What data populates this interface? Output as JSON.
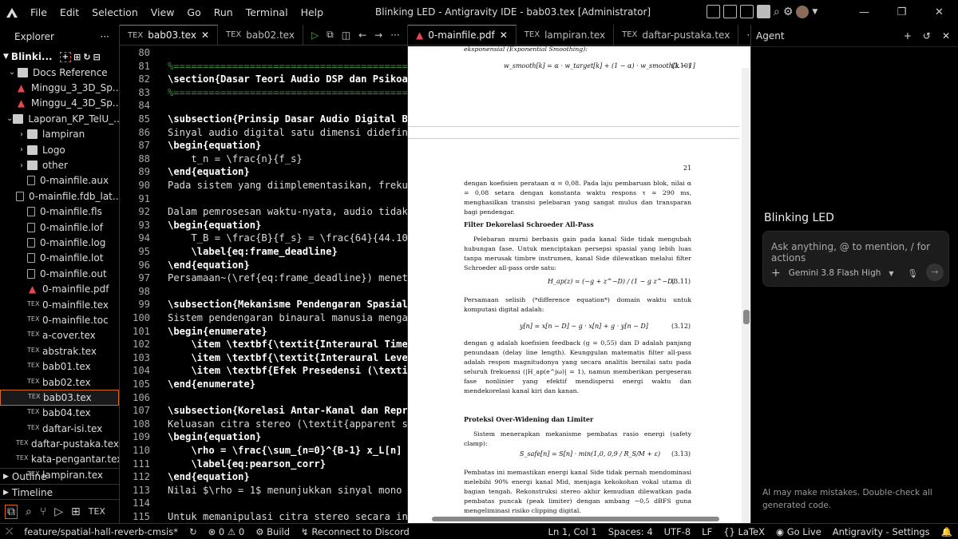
{
  "title": {
    "menu": [
      "File",
      "Edit",
      "Selection",
      "View",
      "Go",
      "Run",
      "Terminal",
      "Help"
    ],
    "window_title": "Blinking LED - Antigravity IDE - bab03.tex [Administrator]"
  },
  "sidebar": {
    "header": "Explorer",
    "root": "Blinki...",
    "items": [
      {
        "label": "Docs Reference",
        "type": "folder-open",
        "indent": 1
      },
      {
        "label": "Minggu_3_3D_Sp...",
        "type": "pdf",
        "indent": 2
      },
      {
        "label": "Minggu_4_3D_Sp...",
        "type": "pdf",
        "indent": 2
      },
      {
        "label": "Laporan_KP_TelU_...",
        "type": "folder-open",
        "indent": 1
      },
      {
        "label": "lampiran",
        "type": "folder",
        "indent": 2
      },
      {
        "label": "Logo",
        "type": "folder",
        "indent": 2
      },
      {
        "label": "other",
        "type": "folder",
        "indent": 2
      },
      {
        "label": "0-mainfile.aux",
        "type": "file",
        "indent": 2
      },
      {
        "label": "0-mainfile.fdb_lat...",
        "type": "file",
        "indent": 2
      },
      {
        "label": "0-mainfile.fls",
        "type": "file",
        "indent": 2
      },
      {
        "label": "0-mainfile.lof",
        "type": "file",
        "indent": 2
      },
      {
        "label": "0-mainfile.log",
        "type": "file",
        "indent": 2
      },
      {
        "label": "0-mainfile.lot",
        "type": "file",
        "indent": 2
      },
      {
        "label": "0-mainfile.out",
        "type": "file",
        "indent": 2
      },
      {
        "label": "0-mainfile.pdf",
        "type": "pdf",
        "indent": 2
      },
      {
        "label": "0-mainfile.tex",
        "type": "tex",
        "indent": 2
      },
      {
        "label": "0-mainfile.toc",
        "type": "tex",
        "indent": 2
      },
      {
        "label": "a-cover.tex",
        "type": "tex",
        "indent": 2
      },
      {
        "label": "abstrak.tex",
        "type": "tex",
        "indent": 2
      },
      {
        "label": "bab01.tex",
        "type": "tex",
        "indent": 2
      },
      {
        "label": "bab02.tex",
        "type": "tex",
        "indent": 2
      },
      {
        "label": "bab03.tex",
        "type": "tex",
        "indent": 2,
        "selected": true
      },
      {
        "label": "bab04.tex",
        "type": "tex",
        "indent": 2
      },
      {
        "label": "daftar-isi.tex",
        "type": "tex",
        "indent": 2
      },
      {
        "label": "daftar-pustaka.tex",
        "type": "tex",
        "indent": 2
      },
      {
        "label": "kata-pengantar.tex",
        "type": "tex",
        "indent": 2
      },
      {
        "label": "lampiran.tex",
        "type": "tex",
        "indent": 2
      }
    ],
    "outline": "Outline",
    "timeline": "Timeline"
  },
  "editor": {
    "tabs": [
      {
        "label": "bab03.tex",
        "active": true
      },
      {
        "label": "bab02.tex",
        "active": false
      }
    ],
    "lines": [
      {
        "n": "80",
        "t": ""
      },
      {
        "n": "81",
        "t": "%==========================================="
      },
      {
        "n": "82",
        "t": "\\section{Dasar Teori Audio DSP dan Psikoak"
      },
      {
        "n": "83",
        "t": "%==========================================="
      },
      {
        "n": "84",
        "t": ""
      },
      {
        "n": "85",
        "t": "\\subsection{Prinsip Dasar Audio Digital Be"
      },
      {
        "n": "86",
        "t": "Sinyal audio digital satu dimensi didefini"
      },
      {
        "n": "87",
        "t": "\\begin{equation}"
      },
      {
        "n": "88",
        "t": "    t_n = \\frac{n}{f_s}"
      },
      {
        "n": "89",
        "t": "\\end{equation}"
      },
      {
        "n": "90",
        "t": "Pada sistem yang diimplementasikan, frekue"
      },
      {
        "n": "91",
        "t": ""
      },
      {
        "n": "92",
        "t": "Dalam pemrosesan waktu-nyata, audio tidak"
      },
      {
        "n": "93",
        "t": "\\begin{equation}"
      },
      {
        "n": "94",
        "t": "    T_B = \\frac{B}{f_s} = \\frac{64}{44.100"
      },
      {
        "n": "95",
        "t": "    \\label{eq:frame_deadline}"
      },
      {
        "n": "96",
        "t": "\\end{equation}"
      },
      {
        "n": "97",
        "t": "Persamaan~(\\ref{eq:frame_deadline}) meneta"
      },
      {
        "n": "98",
        "t": ""
      },
      {
        "n": "99",
        "t": "\\subsection{Mekanisme Pendengaran Spasial"
      },
      {
        "n": "100",
        "t": "Sistem pendengaran binaural manusia mengan"
      },
      {
        "n": "101",
        "t": "\\begin{enumerate}"
      },
      {
        "n": "102",
        "t": "    \\item \\textbf{\\textit{Interaural Time"
      },
      {
        "n": "103",
        "t": "    \\item \\textbf{\\textit{Interaural Level"
      },
      {
        "n": "104",
        "t": "    \\item \\textbf{Efek Presedensi (\\textit"
      },
      {
        "n": "105",
        "t": "\\end{enumerate}"
      },
      {
        "n": "106",
        "t": ""
      },
      {
        "n": "107",
        "t": "\\subsection{Korelasi Antar-Kanal dan Repre"
      },
      {
        "n": "108",
        "t": "Keluasan citra stereo (\\textit{apparent so"
      },
      {
        "n": "109",
        "t": "\\begin{equation}"
      },
      {
        "n": "110",
        "t": "    \\rho = \\frac{\\sum_{n=0}^{B-1} x_L[n] x"
      },
      {
        "n": "111",
        "t": "    \\label{eq:pearson_corr}"
      },
      {
        "n": "112",
        "t": "\\end{equation}"
      },
      {
        "n": "113",
        "t": "Nilai $\\rho = 1$ menunjukkan sinyal mono m"
      },
      {
        "n": "114",
        "t": ""
      },
      {
        "n": "115",
        "t": "Untuk memanipulasi citra stereo secara ind"
      }
    ]
  },
  "pdf": {
    "tabs": [
      {
        "label": "0-mainfile.pdf",
        "active": true
      },
      {
        "label": "lampiran.tex",
        "active": false
      },
      {
        "label": "daftar-pustaka.tex",
        "active": false
      }
    ],
    "top_caption": "eksponensial (Exponential Smoothing):",
    "eq310": "w_smooth[k] = α · w_target[k] + (1 − α) · w_smooth[k − 1]",
    "eq310n": "(3.10)",
    "page": "21",
    "p1": "dengan koefisien perataan α = 0,08. Pada laju pembaruan blok, nilai α = 0,08 setara dengan konstanta waktu respons τ ≈ 290 ms, menghasilkan transisi pelebaran yang sangat mulus dan transparan bagi pendengar.",
    "h1": "Filter Dekorelasi Schroeder All-Pass",
    "p2": "Pelebaran murni berbasis gain pada kanal Side tidak mengubah hubungan fase. Untuk menciptakan persepsi spasial yang lebih luas tanpa merusak timbre instrumen, kanal Side dilewatkan melalui filter Schroeder all-pass orde satu:",
    "eq311": "H_ap(z) = (−g + z^−D) / (1 − g z^−D)",
    "eq311n": "(3.11)",
    "p3": "Persamaan selisih (*difference equation*) domain waktu untuk komputasi digital adalah:",
    "eq312": "y[n] = x[n − D] − g · x[n] + g · y[n − D]",
    "eq312n": "(3.12)",
    "p4": "dengan g adalah koefisien feedback (g = 0,55) dan D adalah panjang penundaan (delay line length). Keunggulan matematis filter all-pass adalah respon magnitudonya yang secara analitis bernilai satu pada seluruh frekuensi (|H_ap(e^jω)| = 1), namun memberikan pergeseran fase nonlinier yang efektif mendispersi energi waktu dan mendekorelasi kanal kiri dan kanan.",
    "h2": "Proteksi Over-Widening dan Limiter",
    "p5": "Sistem menerapkan mekanisme pembatas rasio energi (safety clamp):",
    "eq313": "S_safe[n] = S[n] · min(1,0, 0,9 / R_S/M + ε)",
    "eq313n": "(3.13)",
    "p6": "Pembatas ini memastikan energi kanal Side tidak pernah mendominasi melebihi 90% energi kanal Mid, menjaga kekokohan vokal utama di bagian tengah. Rekonstruksi stereo akhir kemudian dilewatkan pada pembatas puncak (peak limiter) dengan ambang −0,5 dBFS guna mengeliminasi risiko clipping digital."
  },
  "agent": {
    "header": "Agent",
    "title": "Blinking LED",
    "placeholder": "Ask anything, @ to mention, / for actions",
    "model": "Gemini 3.8 Flash High",
    "footer": "AI may make mistakes. Double-check all generated code."
  },
  "status": {
    "branch": "feature/spatial-hall-reverb-cmsis*",
    "errors": "0",
    "warnings": "0",
    "build": "Build",
    "discord": "Reconnect to Discord",
    "position": "Ln 1, Col 1",
    "spaces": "Spaces: 4",
    "encoding": "UTF-8",
    "eol": "LF",
    "lang": "LaTeX",
    "golive": "Go Live",
    "settings": "Antigravity - Settings"
  },
  "colors": {
    "accent": "#d36a1f",
    "comment": "#3b8c3b",
    "bracket": "#e6c84f",
    "pdf_icon": "#e5474e"
  }
}
